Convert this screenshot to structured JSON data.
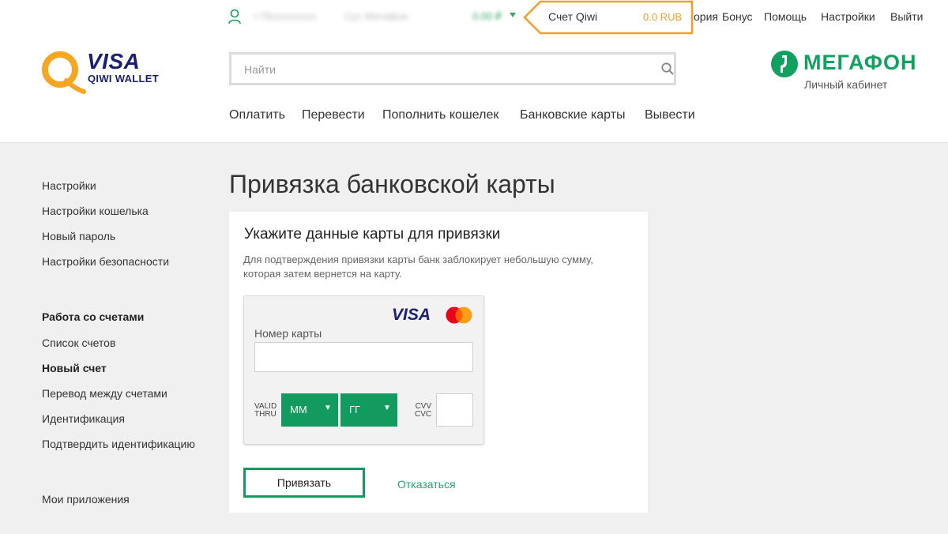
{
  "topbar": {
    "phone": "+79xxxxxxxxx",
    "operator": "Сус Мегафон",
    "balance": "0.00 ₽",
    "account_label": "Счет Qiwi",
    "account_amount": "0.0 RUB",
    "links": [
      "ория",
      "Бонус",
      "Помощь",
      "Настройки",
      "Выйти"
    ]
  },
  "logo": {
    "visa": "VISA",
    "wallet": "QIWI WALLET"
  },
  "search": {
    "placeholder": "Найти"
  },
  "megafon": {
    "name": "МЕГАФОН",
    "subtitle": "Личный кабинет"
  },
  "nav": [
    "Оплатить",
    "Перевести",
    "Пополнить кошелек",
    "Банковские карты",
    "Вывести"
  ],
  "sidebar": {
    "group1": [
      "Настройки",
      "Настройки кошелька",
      "Новый пароль",
      "Настройки безопасности"
    ],
    "group2_title": "Работа со счетами",
    "group2": [
      "Список счетов",
      "Новый счет",
      "Перевод между счетами",
      "Идентификация",
      "Подтвердить идентификацию"
    ],
    "apps": "Мои приложения"
  },
  "page": {
    "title": "Привязка банковской карты",
    "panel_title": "Укажите данные карты для привязки",
    "panel_desc": "Для подтверждения привязки карты банк заблокирует небольшую сумму, которая затем вернется на карту.",
    "card_visa": "VISA",
    "card_number_label": "Номер карты",
    "card_number_value": "",
    "valid_thru_1": "VALID",
    "valid_thru_2": "THRU",
    "month_value": "ММ",
    "year_value": "ГГ",
    "cvv_1": "CVV",
    "cvv_2": "CVC",
    "cvv_value": "",
    "bind_button": "Привязать",
    "cancel_link": "Отказаться"
  },
  "colors": {
    "green": "#129a5f",
    "orange": "#f0a02a",
    "visa_blue": "#1a1f71",
    "megafon_green": "#10a160"
  }
}
